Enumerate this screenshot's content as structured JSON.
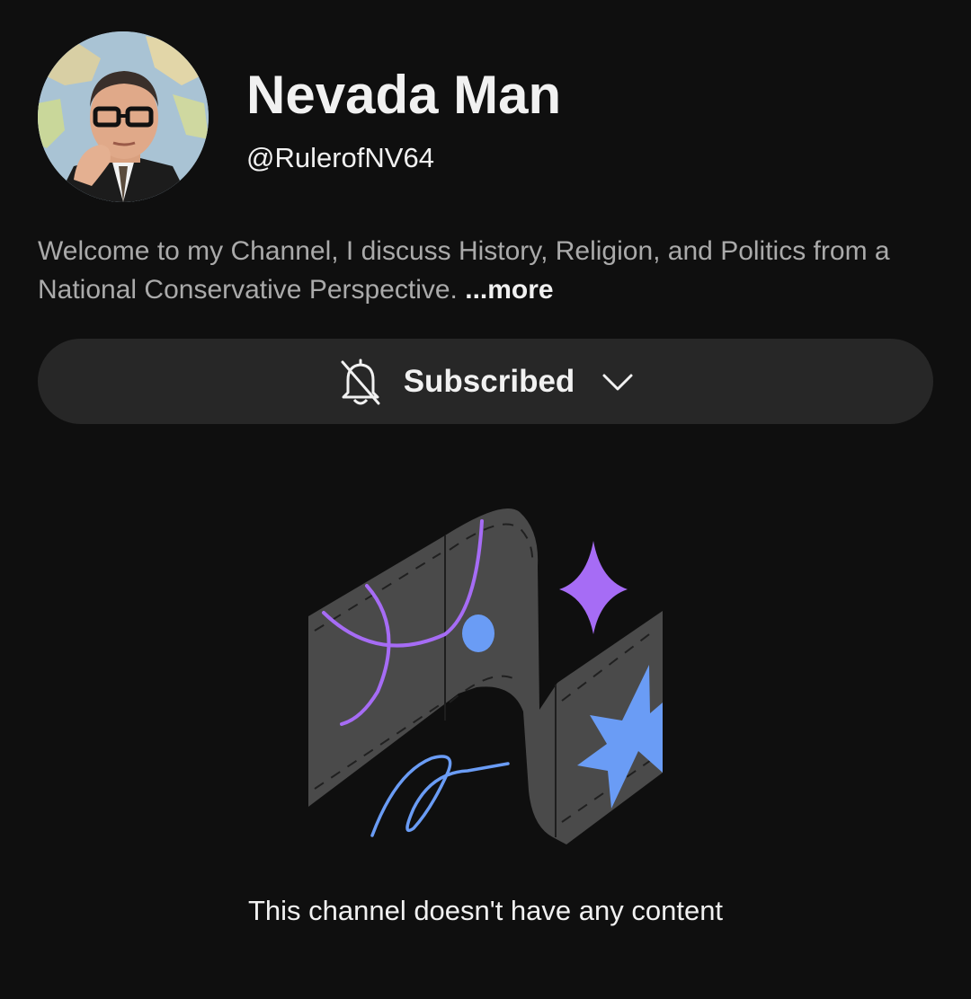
{
  "channel": {
    "name": "Nevada Man",
    "handle": "@RulerofNV64",
    "description": "Welcome to my Channel, I discuss History, Religion, and Politics from a National Conservative Perspective.",
    "more_label": "...more",
    "avatar_icon": "profile-photo"
  },
  "subscribe": {
    "label": "Subscribed",
    "bell_icon": "bell-off-icon",
    "chevron_icon": "chevron-down-icon"
  },
  "empty_state": {
    "message": "This channel doesn't have any content",
    "illustration": "empty-channel-illustration"
  },
  "colors": {
    "background": "#0f0f0f",
    "button_bg": "#272727",
    "text_primary": "#f1f1f1",
    "text_secondary": "#aaaaaa",
    "accent_purple": "#a66cf5",
    "accent_blue": "#6a9cf5"
  }
}
